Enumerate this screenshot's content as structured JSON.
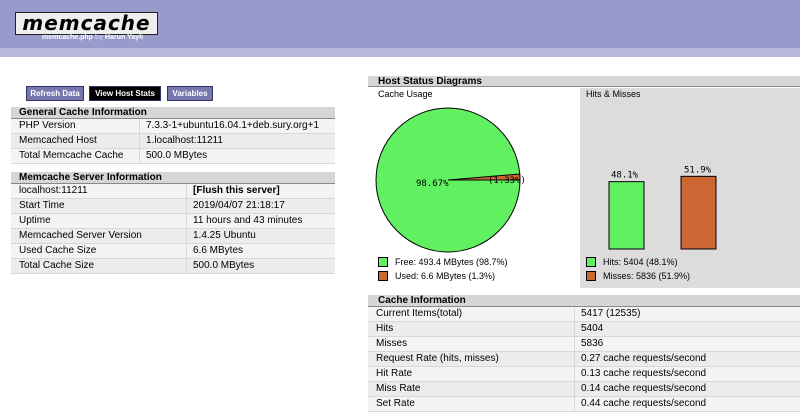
{
  "header": {
    "logo": "memcache",
    "subtitle_file": "memcache.php",
    "subtitle_by": "by",
    "subtitle_author": "Harun Yayli"
  },
  "nav": {
    "refresh": "Refresh Data",
    "host_stats": "View Host Stats",
    "variables": "Variables"
  },
  "general": {
    "title": "General Cache Information",
    "rows": [
      {
        "k": "PHP Version",
        "v": "7.3.3-1+ubuntu16.04.1+deb.sury.org+1"
      },
      {
        "k": "Memcached Host",
        "v": "1.localhost:11211"
      },
      {
        "k": "Total Memcache Cache",
        "v": "500.0 MBytes"
      }
    ]
  },
  "server": {
    "title": "Memcache Server Information",
    "rows": [
      {
        "k": "localhost:11211",
        "v": "[Flush this server]"
      },
      {
        "k": "Start Time",
        "v": "2019/04/07 21:18:17"
      },
      {
        "k": "Uptime",
        "v": "11 hours and 43 minutes"
      },
      {
        "k": "Memcached Server Version",
        "v": "1.4.25 Ubuntu"
      },
      {
        "k": "Used Cache Size",
        "v": "6.6 MBytes"
      },
      {
        "k": "Total Cache Size",
        "v": "500.0 MBytes"
      }
    ]
  },
  "diagrams": {
    "title": "Host Status Diagrams",
    "cache_usage_title": "Cache Usage",
    "hits_misses_title": "Hits & Misses",
    "pie_free_label": "98.67%",
    "pie_used_label": "(1.33%)",
    "pie_free_fraction": 0.9867,
    "hits_pct_label": "48.1%",
    "misses_pct_label": "51.9%",
    "hits_fraction": 0.481,
    "misses_fraction": 0.519,
    "legend_free": "Free: 493.4 MBytes (98.7%)",
    "legend_used": "Used: 6.6 MBytes (1.3%)",
    "legend_hits": "Hits: 5404 (48.1%)",
    "legend_misses": "Misses: 5836 (51.9%)",
    "colors": {
      "free": "#60f060",
      "used": "#cc6633",
      "hits": "#60f060",
      "misses": "#cc6633"
    }
  },
  "cache_info": {
    "title": "Cache Information",
    "rows": [
      {
        "k": "Current Items(total)",
        "v": "5417 (12535)"
      },
      {
        "k": "Hits",
        "v": "5404"
      },
      {
        "k": "Misses",
        "v": "5836"
      },
      {
        "k": "Request Rate (hits, misses)",
        "v": "0.27 cache requests/second"
      },
      {
        "k": "Hit Rate",
        "v": "0.13 cache requests/second"
      },
      {
        "k": "Miss Rate",
        "v": "0.14 cache requests/second"
      },
      {
        "k": "Set Rate",
        "v": "0.44 cache requests/second"
      }
    ]
  }
}
